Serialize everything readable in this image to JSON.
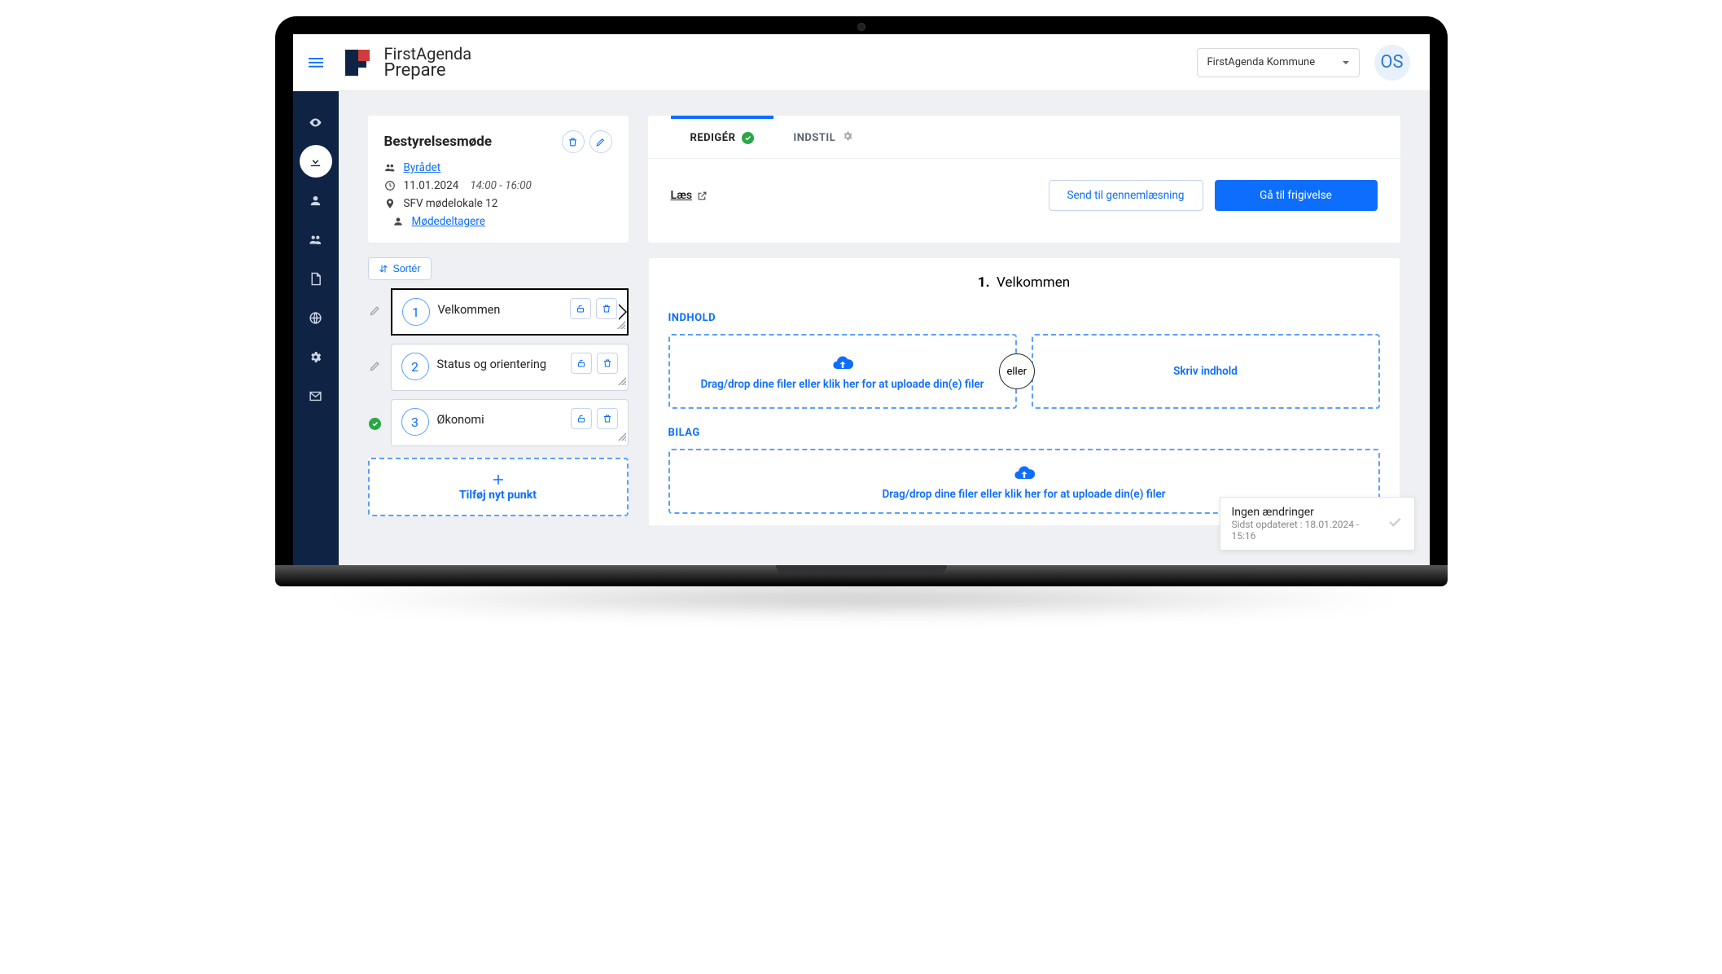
{
  "header": {
    "brand_line1": "FirstAgenda",
    "brand_line2": "Prepare",
    "org": "FirstAgenda Kommune",
    "avatar_initials": "OS"
  },
  "meeting": {
    "title": "Bestyrelsesmøde",
    "committee": "Byrådet",
    "date": "11.01.2024",
    "time": "14:00 - 16:00",
    "room": "SFV mødelokale 12",
    "participants_link": "Mødedeltagere"
  },
  "tabs": {
    "edit": "REDIGÉR",
    "settings": "INDSTIL"
  },
  "actions": {
    "read": "Læs",
    "send_review": "Send til gennemlæsning",
    "go_release": "Gå til frigivelse"
  },
  "sort_label": "Sortér",
  "agenda": [
    {
      "num": "1",
      "title": "Velkommen",
      "selected": true,
      "status": "none"
    },
    {
      "num": "2",
      "title": "Status og orientering",
      "selected": false,
      "status": "none"
    },
    {
      "num": "3",
      "title": "Økonomi",
      "selected": false,
      "status": "ok"
    }
  ],
  "add_item_label": "Tilføj nyt punkt",
  "detail": {
    "heading_num": "1.",
    "heading_text": "Velkommen",
    "content_label": "INDHOLD",
    "attachments_label": "BILAG",
    "drop_text": "Drag/drop dine filer eller klik her for at uploade din(e) filer",
    "or_label": "eller",
    "write_content": "Skriv indhold",
    "drop_text_2": "Drag/drop dine filer eller klik her for at uploade din(e) filer"
  },
  "toast": {
    "title": "Ingen ændringer",
    "subtitle": "Sidst opdateret : 18.01.2024 - 15:16"
  }
}
